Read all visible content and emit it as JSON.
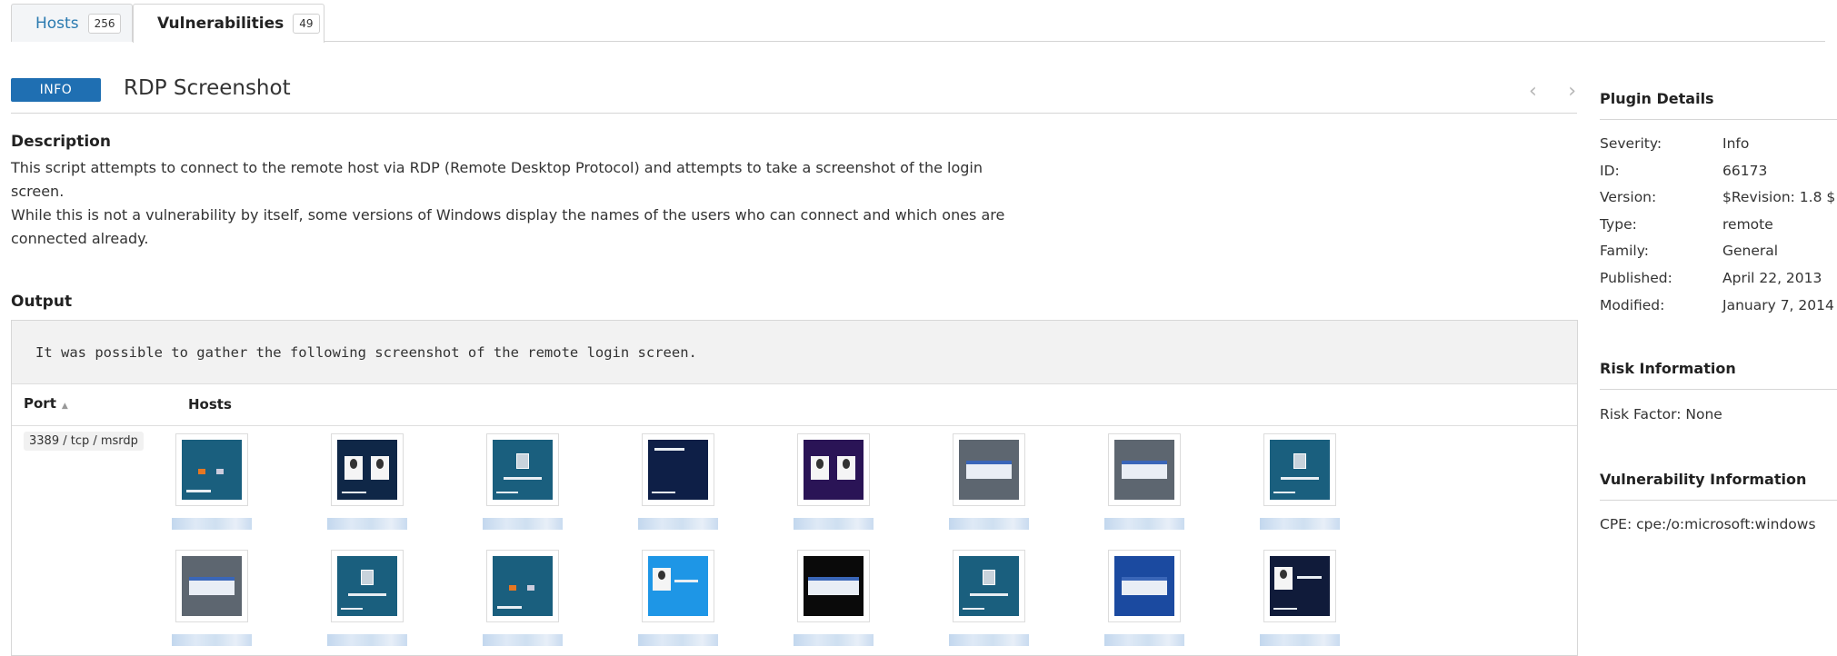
{
  "tabs": [
    {
      "label": "Hosts",
      "count": "256"
    },
    {
      "label": "Vulnerabilities",
      "count": "49"
    }
  ],
  "plugin": {
    "severity_badge": "INFO",
    "title": "RDP Screenshot",
    "prev_icon": "chevron-left-icon",
    "next_icon": "chevron-right-icon"
  },
  "description": {
    "heading": "Description",
    "para1": "This script attempts to connect to the remote host via RDP (Remote Desktop Protocol) and attempts to take a screenshot of the login screen.",
    "para2": "While this is not a vulnerability by itself, some versions of Windows display the names of the users who can connect and which ones are connected already."
  },
  "output": {
    "heading": "Output",
    "message": "It was possible to gather the following screenshot of the remote login screen.",
    "col_port": "Port",
    "col_hosts": "Hosts",
    "port_value": "3389 / tcp / msrdp",
    "screenshots": [
      {
        "theme": "teal-boot"
      },
      {
        "theme": "navy-users"
      },
      {
        "theme": "teal-lock"
      },
      {
        "theme": "deep-blue"
      },
      {
        "theme": "purple-users"
      },
      {
        "theme": "gray-dialog"
      },
      {
        "theme": "gray-dialog"
      },
      {
        "theme": "teal-lock"
      },
      {
        "theme": "gray-dialog"
      },
      {
        "theme": "teal-lock"
      },
      {
        "theme": "teal-boot"
      },
      {
        "theme": "sky-user"
      },
      {
        "theme": "black-dialog"
      },
      {
        "theme": "teal-lock"
      },
      {
        "theme": "xp-dialog"
      },
      {
        "theme": "dark-user"
      }
    ]
  },
  "plugin_details": {
    "heading": "Plugin Details",
    "rows": [
      {
        "key": "Severity:",
        "value": "Info"
      },
      {
        "key": "ID:",
        "value": "66173"
      },
      {
        "key": "Version:",
        "value": "$Revision: 1.8 $"
      },
      {
        "key": "Type:",
        "value": "remote"
      },
      {
        "key": "Family:",
        "value": "General"
      },
      {
        "key": "Published:",
        "value": "April 22, 2013"
      },
      {
        "key": "Modified:",
        "value": "January 7, 2014"
      }
    ]
  },
  "risk_information": {
    "heading": "Risk Information",
    "risk_factor": "Risk Factor: None"
  },
  "vulnerability_information": {
    "heading": "Vulnerability Information",
    "cpe": "CPE: cpe:/o:microsoft:windows"
  },
  "colors": {
    "accent": "#1f6fb2",
    "link": "#2a7ab0"
  }
}
